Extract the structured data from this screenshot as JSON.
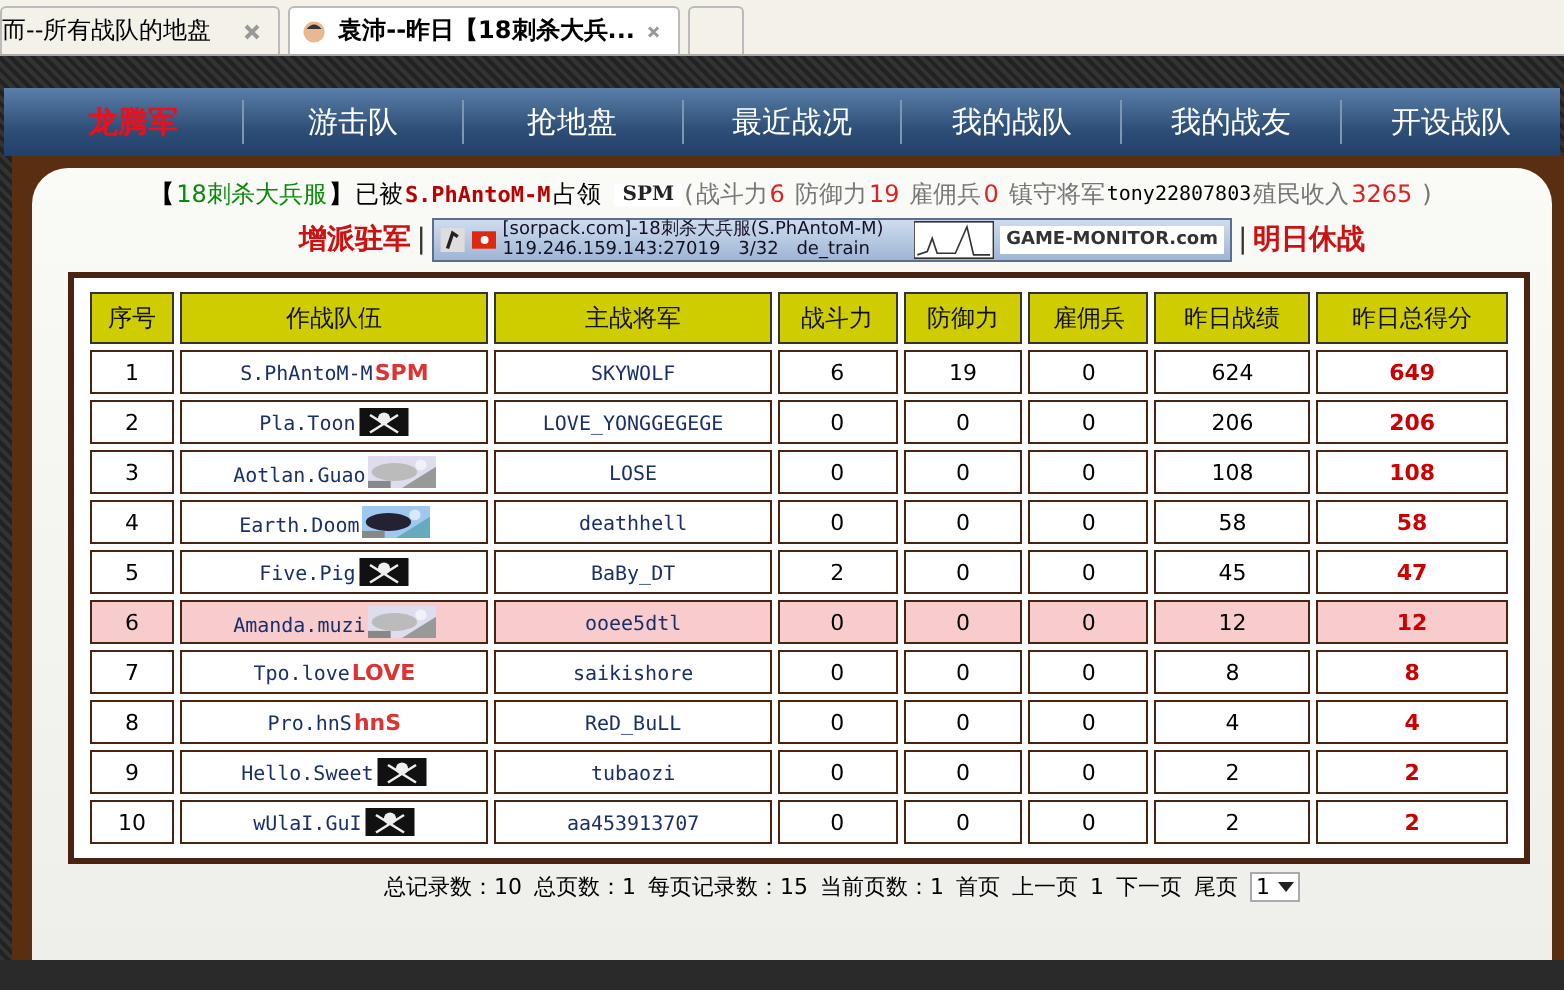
{
  "browser_tabs": [
    {
      "title": "而--所有战队的地盘",
      "selected": false
    },
    {
      "title": "袁沛--昨日【18刺杀大兵...",
      "selected": true
    }
  ],
  "nav": [
    {
      "label": "龙腾军",
      "selected": true
    },
    {
      "label": "游击队",
      "selected": false
    },
    {
      "label": "抢地盘",
      "selected": false
    },
    {
      "label": "最近战况",
      "selected": false
    },
    {
      "label": "我的战队",
      "selected": false
    },
    {
      "label": "我的战友",
      "selected": false
    },
    {
      "label": "开设战队",
      "selected": false
    }
  ],
  "server_info": {
    "open_bracket": "【",
    "close_bracket": "】",
    "open_paren": "(",
    "close_paren": ")",
    "server": "18刺杀大兵服",
    "occupied_text": "已被",
    "owner": "S.PhAntoM-M",
    "occupied_suffix": "占领",
    "owner_badge": "SPM",
    "stats": [
      {
        "label": "战斗力",
        "value": "6"
      },
      {
        "label": "防御力",
        "value": "19"
      },
      {
        "label": "雇佣兵",
        "value": "0"
      }
    ],
    "general_label": "镇守将军",
    "general": "tony22807803",
    "income_label": "殖民收入",
    "income": "3265"
  },
  "actions": {
    "separator": "|",
    "left": "增派驻军",
    "right": "明日休战"
  },
  "banner": {
    "line1": "[sorpack.com]-18刺杀大兵服(S.PhAntoM-M)",
    "address": "119.246.159.143:27019",
    "players": "3/32",
    "map": "de_train",
    "brand": "GAME-MONITOR.com"
  },
  "table": {
    "columns": [
      "序号",
      "作战队伍",
      "主战将军",
      "战斗力",
      "防御力",
      "雇佣兵",
      "昨日战绩",
      "昨日总得分"
    ],
    "rows": [
      {
        "no": "1",
        "team": "S.PhAntoM-M",
        "badge": {
          "kind": "text",
          "text": "SPM"
        },
        "general": "SKYWOLF",
        "attack": "6",
        "defense": "19",
        "mercs": "0",
        "record": "624",
        "score": "649",
        "highlighted": false
      },
      {
        "no": "2",
        "team": "Pla.Toon",
        "badge": {
          "kind": "pirate"
        },
        "general": "LOVE_YONGGEGEGE",
        "attack": "0",
        "defense": "0",
        "mercs": "0",
        "record": "206",
        "score": "206",
        "highlighted": false
      },
      {
        "no": "3",
        "team": "Aotlan.Guao",
        "general": "LOSE",
        "attack": "0",
        "defense": "0",
        "mercs": "0",
        "record": "108",
        "score": "108",
        "highlighted": false
      },
      {
        "no": "4",
        "team": "Earth.Doom",
        "general": "deathhell",
        "attack": "0",
        "defense": "0",
        "mercs": "0",
        "record": "58",
        "score": "58",
        "highlighted": false
      },
      {
        "no": "5",
        "team": "Five.Pig",
        "badge": {
          "kind": "pirate"
        },
        "general": "BaBy_DT",
        "attack": "2",
        "defense": "0",
        "mercs": "0",
        "record": "45",
        "score": "47",
        "highlighted": false
      },
      {
        "no": "6",
        "team": "Amanda.muzi",
        "general": "ooee5dtl",
        "attack": "0",
        "defense": "0",
        "mercs": "0",
        "record": "12",
        "score": "12",
        "highlighted": true
      },
      {
        "no": "7",
        "team": "Tpo.love",
        "badge": {
          "kind": "text",
          "text": "LOVE"
        },
        "general": "saikishore",
        "attack": "0",
        "defense": "0",
        "mercs": "0",
        "record": "8",
        "score": "8",
        "highlighted": false
      },
      {
        "no": "8",
        "team": "Pro.hnS",
        "badge": {
          "kind": "text",
          "text": "hnS"
        },
        "general": "ReD_BuLL",
        "attack": "0",
        "defense": "0",
        "mercs": "0",
        "record": "4",
        "score": "4",
        "highlighted": false
      },
      {
        "no": "9",
        "team": "Hello.Sweet",
        "badge": {
          "kind": "pirate"
        },
        "general": "tubaozi",
        "attack": "0",
        "defense": "0",
        "mercs": "0",
        "record": "2",
        "score": "2",
        "highlighted": false
      },
      {
        "no": "10",
        "team": "wUlaI.GuI",
        "badge": {
          "kind": "pirate"
        },
        "general": "aa453913707",
        "attack": "0",
        "defense": "0",
        "mercs": "0",
        "record": "2",
        "score": "2",
        "highlighted": false
      }
    ]
  },
  "pager": {
    "total_records": "总记录数：10",
    "total_pages": "总页数：1",
    "per_page": "每页记录数：15",
    "current_page": "当前页数：1",
    "links": [
      "首页",
      "上一页",
      "1",
      "下一页",
      "尾页"
    ],
    "select_value": "1"
  }
}
